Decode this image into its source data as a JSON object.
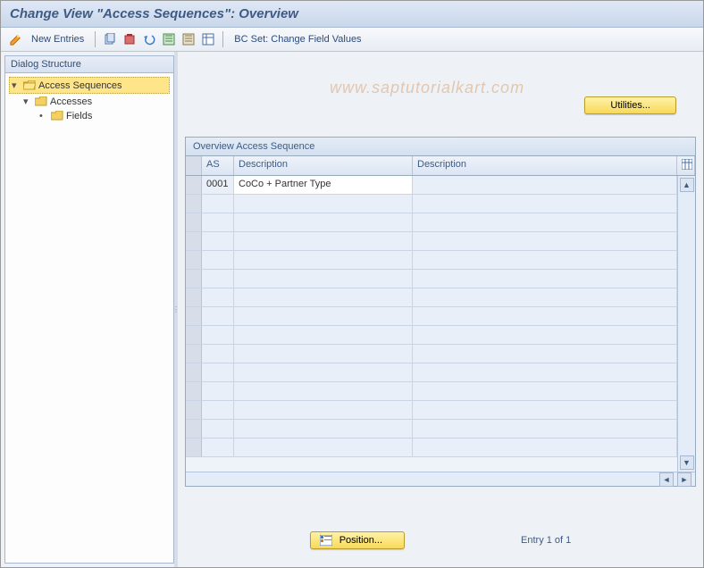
{
  "title": "Change View \"Access Sequences\": Overview",
  "toolbar": {
    "new_entries": "New Entries",
    "bc_set": "BC Set: Change Field Values"
  },
  "sidebar": {
    "header": "Dialog Structure",
    "nodes": {
      "root": "Access Sequences",
      "child1": "Accesses",
      "child2": "Fields"
    }
  },
  "utilities_label": "Utilities...",
  "grid": {
    "title": "Overview Access Sequence",
    "cols": {
      "as": "AS",
      "desc1": "Description",
      "desc2": "Description"
    },
    "rows": [
      {
        "as": "0001",
        "desc1": "CoCo + Partner Type",
        "desc2": ""
      }
    ]
  },
  "position_label": "Position...",
  "entry_text": "Entry 1 of 1",
  "watermark": "www.saptutorialkart.com"
}
